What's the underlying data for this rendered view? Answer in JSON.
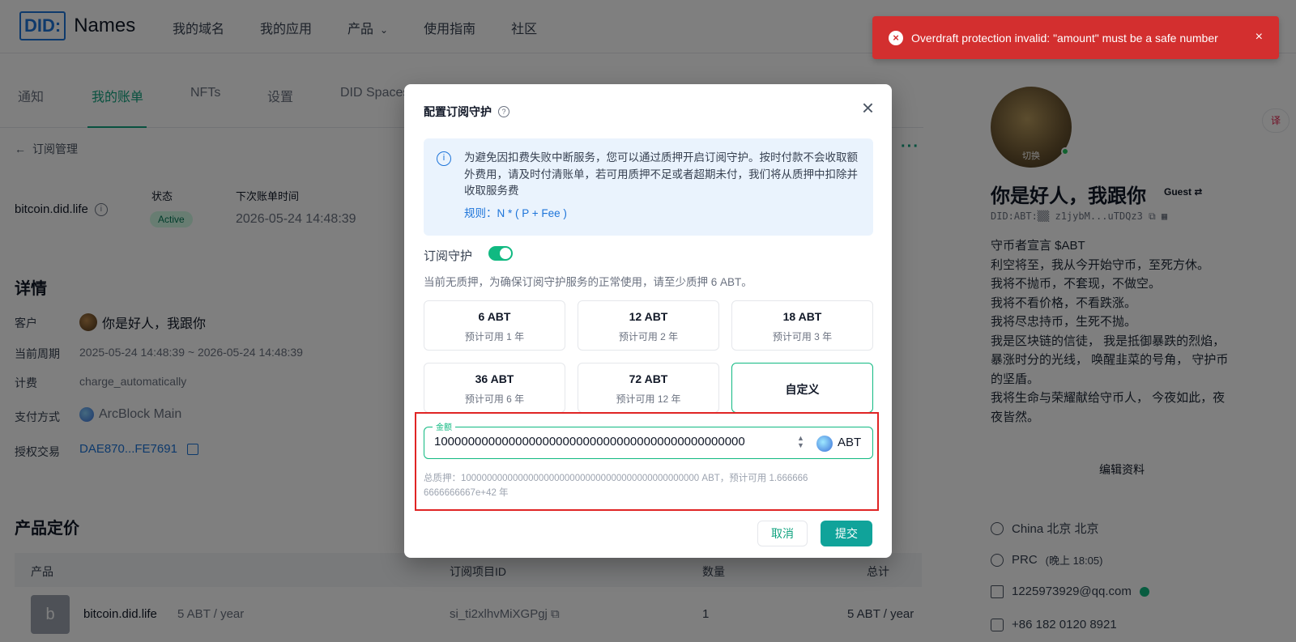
{
  "topbar": {
    "logo_mark": "DID:",
    "logo_name": "Names",
    "nav": [
      "我的域名",
      "我的应用",
      "产品",
      "使用指南",
      "社区"
    ]
  },
  "tabs": [
    "通知",
    "我的账单",
    "NFTs",
    "设置",
    "DID Spaces"
  ],
  "back_label": "订阅管理",
  "subscription": {
    "name": "bitcoin.did.life",
    "status_label": "状态",
    "status": "Active",
    "next_bill_label": "下次账单时间",
    "next_bill": "2026-05-24 14:48:39"
  },
  "details": {
    "heading": "详情",
    "customer_label": "客户",
    "customer": "你是好人，我跟你",
    "period_label": "当前周期",
    "period": "2025-05-24 14:48:39 ~ 2026-05-24 14:48:39",
    "billing_label": "计费",
    "billing": "charge_automatically",
    "payment_label": "支付方式",
    "payment": "ArcBlock Main",
    "auth_label": "授权交易",
    "auth_tx": "DAE870...FE7691"
  },
  "pricing": {
    "heading": "产品定价",
    "columns": [
      "产品",
      "订阅项目ID",
      "数量",
      "总计"
    ],
    "rows": [
      {
        "avatar": "b",
        "product": "bitcoin.did.life",
        "price": "5 ABT / year",
        "item_id": "si_ti2xlhvMiXGPgj",
        "qty": "1",
        "total": "5 ABT / year"
      }
    ]
  },
  "profile": {
    "switch_label": "切换",
    "name": "你是好人，我跟你",
    "role": "Guest",
    "did": "DID:ABT:▒▒ z1jybM...uTDQz3",
    "bio": [
      "守币者宣言 $ABT",
      "利空将至，我从今开始守币，至死方休。",
      "我将不抛币，不套现，不做空。",
      "我将不看价格，不看跌涨。",
      "我将尽忠持币，生死不抛。",
      "我是区块链的信徒， 我是抵御暴跌的烈焰， 暴涨时分的光线， 唤醒韭菜的号角， 守护币的坚盾。",
      "我将生命与荣耀献给守币人， 今夜如此，夜夜皆然。"
    ],
    "edit_label": "编辑资料",
    "location": "China 北京 北京",
    "timezone": "PRC",
    "timezone_note": "(晚上 18:05)",
    "email": "1225973929@qq.com",
    "phone": "+86 182 0120 8921"
  },
  "toast": {
    "message": "Overdraft protection invalid: \"amount\" must be a safe number",
    "close": "×"
  },
  "dialog": {
    "title": "配置订阅守护",
    "info": "为避免因扣费失败中断服务，您可以通过质押开启订阅守护。按时付款不会收取额外费用，请及时付清账单，若可用质押不足或者超期未付，我们将从质押中扣除并收取服务费",
    "rule": "规则：N * ( P + Fee )",
    "guard_label": "订阅守护",
    "guard_enabled": true,
    "hint": "当前无质押，为确保订阅守护服务的正常使用，请至少质押 6 ABT。",
    "options": [
      {
        "amount": "6 ABT",
        "years": "预计可用 1 年"
      },
      {
        "amount": "12 ABT",
        "years": "预计可用 2 年"
      },
      {
        "amount": "18 ABT",
        "years": "预计可用 3 年"
      },
      {
        "amount": "36 ABT",
        "years": "预计可用 6 年"
      },
      {
        "amount": "72 ABT",
        "years": "预计可用 12 年"
      }
    ],
    "custom_label": "自定义",
    "amount_label": "金额",
    "amount_value": "1000000000000000000000000000000000000000000000",
    "currency": "ABT",
    "total_text": "总质押：1000000000000000000000000000000000000000000000 ABT，预计可用 1.6666666666666667e+42 年",
    "cancel": "取消",
    "submit": "提交"
  },
  "colors": {
    "accent": "#10a37f",
    "error": "#d32f2f",
    "link": "#1d74d9"
  }
}
